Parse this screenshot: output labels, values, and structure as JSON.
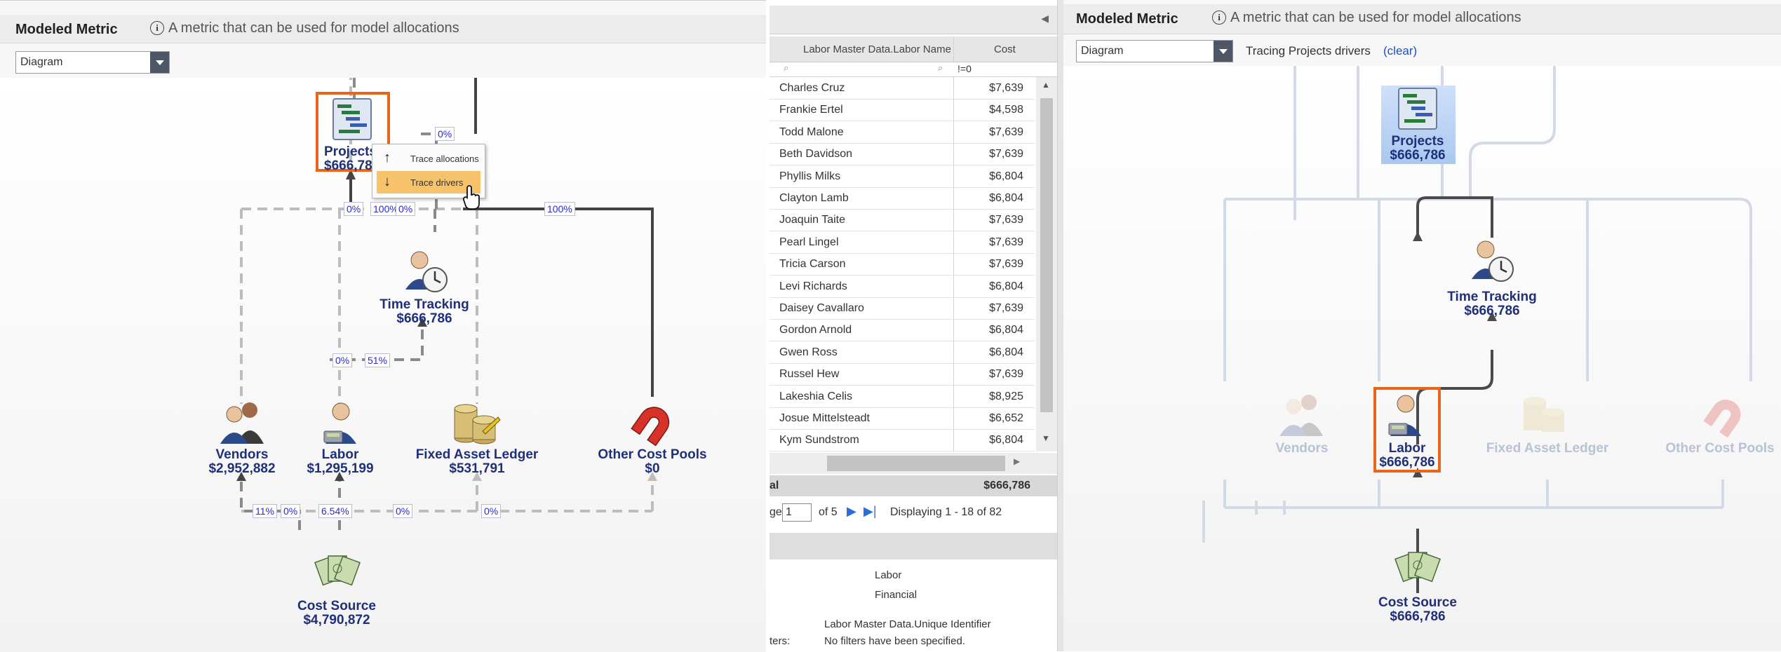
{
  "left_panel": {
    "title": "Modeled Metric",
    "info": "A metric that can be used for model allocations",
    "view_select": "Diagram",
    "nodes": {
      "projects": {
        "label": "Projects",
        "value": "$666,786"
      },
      "time_tracking": {
        "label": "Time Tracking",
        "value": "$666,786"
      },
      "vendors": {
        "label": "Vendors",
        "value": "$2,952,882"
      },
      "labor": {
        "label": "Labor",
        "value": "$1,295,199"
      },
      "fixed_asset": {
        "label": "Fixed Asset Ledger",
        "value": "$531,791"
      },
      "other_cost": {
        "label": "Other Cost Pools",
        "value": "$0"
      },
      "cost_source": {
        "label": "Cost Source",
        "value": "$4,790,872"
      }
    },
    "percents": {
      "p_top": "0%",
      "p_a": "0%",
      "p_b": "100%",
      "p_c": "0%",
      "p_d": "100%",
      "p_e": "0%",
      "p_f": "51%",
      "p_g": "11%",
      "p_h": "0%",
      "p_i": "6.54%",
      "p_j": "0%",
      "p_k": "0%"
    },
    "context_menu": {
      "trace_allocations": "Trace allocations",
      "trace_drivers": "Trace drivers"
    }
  },
  "grid": {
    "col_name": "Labor Master Data.Labor Name",
    "col_cost": "Cost",
    "cost_filter": "!=0",
    "rows": [
      {
        "name": "Charles Cruz",
        "cost": "$7,639"
      },
      {
        "name": "Frankie Ertel",
        "cost": "$4,598"
      },
      {
        "name": "Todd Malone",
        "cost": "$7,639"
      },
      {
        "name": "Beth Davidson",
        "cost": "$7,639"
      },
      {
        "name": "Phyllis Milks",
        "cost": "$6,804"
      },
      {
        "name": "Clayton Lamb",
        "cost": "$6,804"
      },
      {
        "name": "Joaquin Taite",
        "cost": "$7,639"
      },
      {
        "name": "Pearl Lingel",
        "cost": "$7,639"
      },
      {
        "name": "Tricia Carson",
        "cost": "$7,639"
      },
      {
        "name": "Levi Richards",
        "cost": "$6,804"
      },
      {
        "name": "Daisey Cavallaro",
        "cost": "$7,639"
      },
      {
        "name": "Gordon Arnold",
        "cost": "$6,804"
      },
      {
        "name": "Gwen Ross",
        "cost": "$6,804"
      },
      {
        "name": "Russel Hew",
        "cost": "$7,639"
      },
      {
        "name": "Lakeshia Celis",
        "cost": "$8,925"
      },
      {
        "name": "Josue Mittelsteadt",
        "cost": "$6,652"
      },
      {
        "name": "Kym Sundstrom",
        "cost": "$6,804"
      }
    ],
    "total_label": "al",
    "total_value": "$666,786",
    "pager_prefix": "ge",
    "page_input": "1",
    "page_of": "of 5",
    "displaying": "Displaying 1 - 18 of 82",
    "details": {
      "d1": "Labor",
      "d2": "Financial",
      "d3": "Labor Master Data.Unique Identifier",
      "filters_label": "ters:",
      "filters_value": "No filters have been specified."
    }
  },
  "right_panel": {
    "title": "Modeled Metric",
    "info": "A metric that can be used for model allocations",
    "view_select": "Diagram",
    "tracing_text": "Tracing Projects drivers",
    "clear_link": "(clear)",
    "nodes": {
      "projects": {
        "label": "Projects",
        "value": "$666,786"
      },
      "time_tracking": {
        "label": "Time Tracking",
        "value": "$666,786"
      },
      "vendors": {
        "label": "Vendors"
      },
      "labor": {
        "label": "Labor",
        "value": "$666,786"
      },
      "fixed_asset": {
        "label": "Fixed Asset Ledger"
      },
      "other_cost": {
        "label": "Other Cost Pools"
      },
      "cost_source": {
        "label": "Cost Source",
        "value": "$666,786"
      }
    }
  },
  "colors": {
    "highlight": "#e8661c",
    "node_text": "#1f2f7a",
    "link": "#2b2bcf",
    "menu_hover": "#f6c26a"
  }
}
